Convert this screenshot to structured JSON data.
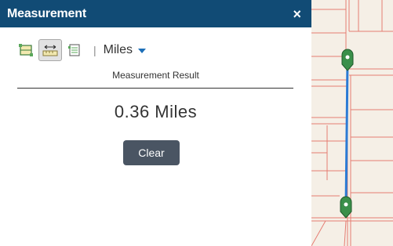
{
  "panel": {
    "title": "Measurement",
    "close_label": "×"
  },
  "toolbar": {
    "tools": [
      {
        "name": "area-tool",
        "icon": "area-measure-icon",
        "active": false
      },
      {
        "name": "distance-tool",
        "icon": "distance-measure-icon",
        "active": true
      },
      {
        "name": "location-tool",
        "icon": "location-measure-icon",
        "active": false
      }
    ],
    "separator": "|",
    "unit": "Miles"
  },
  "result": {
    "label": "Measurement Result",
    "value": "0.36 Miles"
  },
  "actions": {
    "clear_label": "Clear"
  },
  "colors": {
    "header_bg": "#114b75",
    "measure_line": "#2b7bd5",
    "marker": "#3a8f4a",
    "road": "#e8756d",
    "button": "#4a5563"
  }
}
